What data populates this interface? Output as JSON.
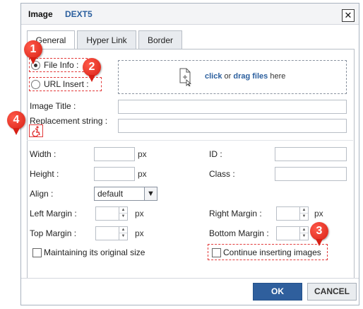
{
  "dialog": {
    "title": "Image",
    "brand": "DEXT5",
    "close_glyph": "✕",
    "close_icon": "close-icon"
  },
  "tabs": [
    {
      "label": "General",
      "active": true
    },
    {
      "label": "Hyper Link",
      "active": false
    },
    {
      "label": "Border",
      "active": false
    }
  ],
  "source": {
    "file_info_label": "File Info :",
    "file_info_checked": true,
    "url_insert_label": "URL Insert :",
    "url_insert_checked": false
  },
  "dropzone": {
    "icon": "file-upload-icon",
    "click_text": "click",
    "or_text": "or",
    "drag_text": "drag files",
    "here_text": "here"
  },
  "fields": {
    "image_title_label": "Image Title :",
    "image_title_value": "",
    "replacement_label": "Replacement string :",
    "replacement_value": "",
    "accessibility_icon": "accessibility-icon"
  },
  "props": {
    "width_label": "Width :",
    "width_value": "",
    "width_unit": "px",
    "height_label": "Height :",
    "height_value": "",
    "height_unit": "px",
    "id_label": "ID :",
    "id_value": "",
    "class_label": "Class :",
    "class_value": "",
    "align_label": "Align :",
    "align_value": "default",
    "left_margin_label": "Left Margin :",
    "left_margin_value": "",
    "left_margin_unit": "px",
    "right_margin_label": "Right Margin :",
    "right_margin_value": "",
    "right_margin_unit": "px",
    "top_margin_label": "Top Margin :",
    "top_margin_value": "",
    "top_margin_unit": "px",
    "bottom_margin_label": "Bottom Margin :",
    "bottom_margin_value": "",
    "bottom_margin_unit": "px"
  },
  "options": {
    "maintain_label": "Maintaining its original size",
    "maintain_checked": false,
    "continue_label": "Continue inserting images",
    "continue_checked": false
  },
  "markers": [
    "1",
    "2",
    "3",
    "4"
  ],
  "buttons": {
    "ok": "OK",
    "cancel": "CANCEL"
  },
  "colors": {
    "accent": "#2f5f9d",
    "marker": "#d71f14",
    "highlight_dash": "#e23a3a"
  }
}
